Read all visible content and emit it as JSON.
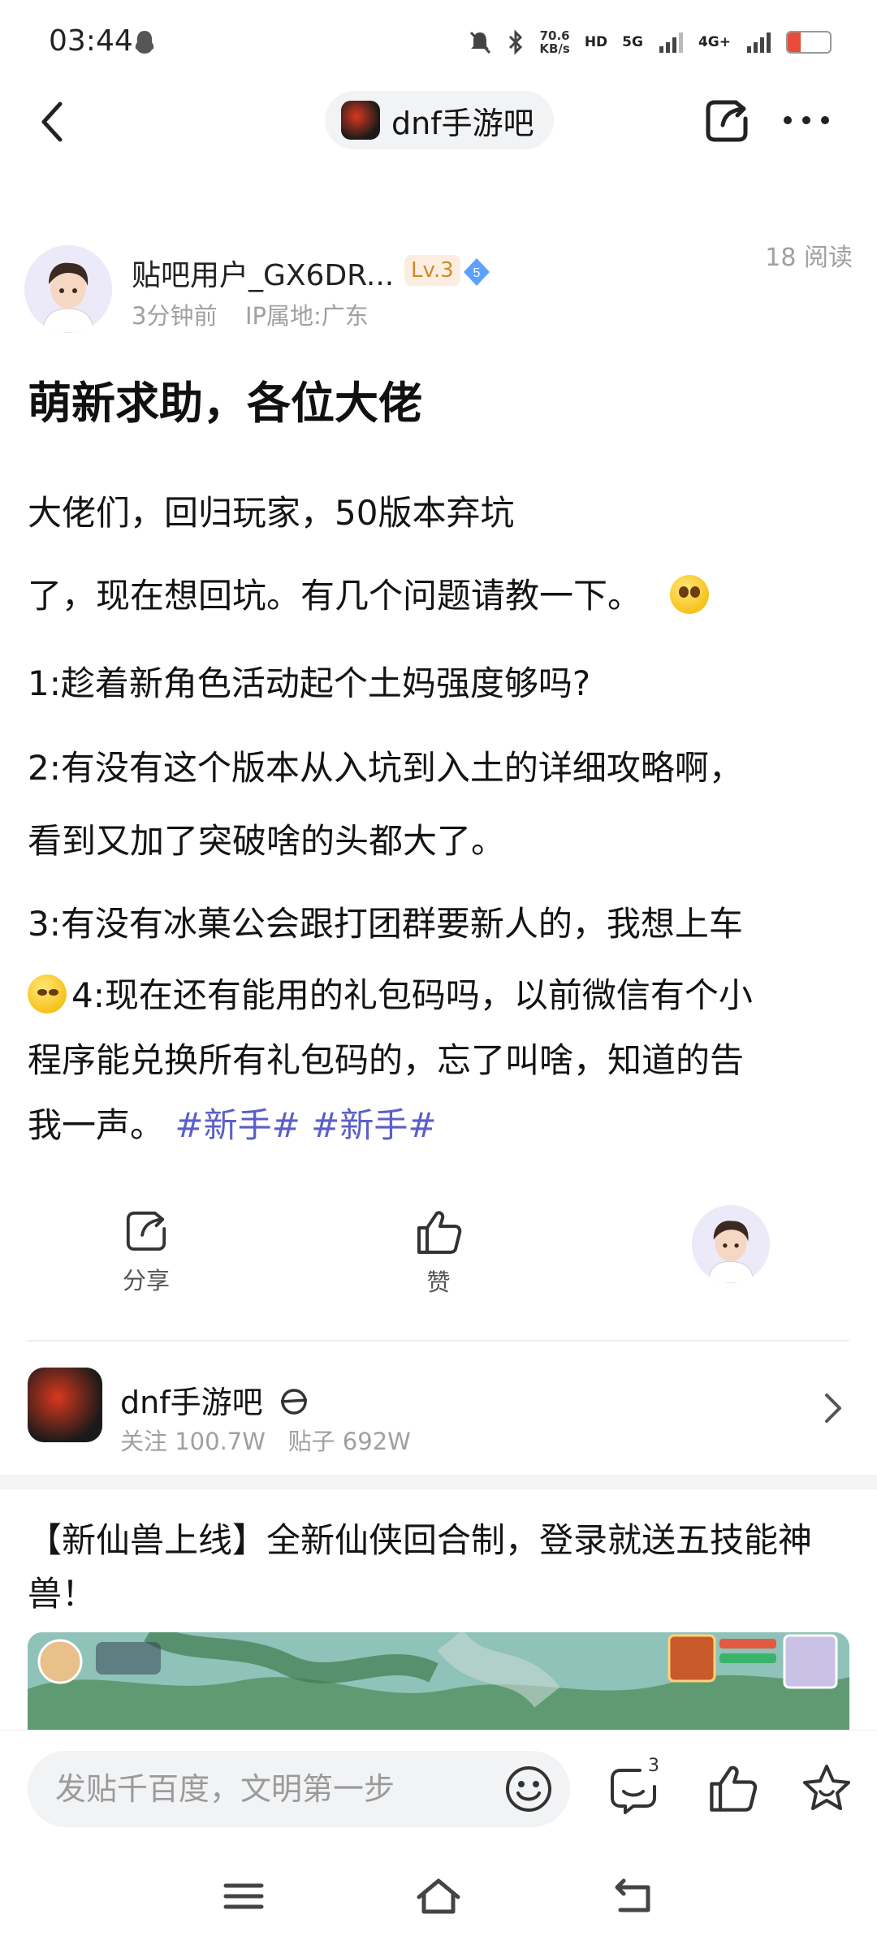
{
  "status_bar": {
    "time": "03:44",
    "net_speed_value": "70.6",
    "net_speed_unit": "KB/s",
    "hd": "HD",
    "sim1": "5G",
    "sim2": "4G+",
    "battery": "15"
  },
  "nav": {
    "forum_name": "dnf手游吧"
  },
  "author": {
    "name": "贴吧用户_GX6DR...",
    "level": "Lv.3",
    "badge_number": "5",
    "time": "3分钟前",
    "ip": "IP属地:广东",
    "reads": "18 阅读"
  },
  "post": {
    "title": "萌新求助，各位大佬",
    "line1": "大佬们，回归玩家，50版本弃坑",
    "line2": "了，现在想回坑。有几个问题请教一下。",
    "line3": "1:趁着新角色活动起个土妈强度够吗?",
    "line4": "2:有没有这个版本从入坑到入土的详细攻略啊，",
    "line5": "看到又加了突破啥的头都大了。",
    "line6": "3:有没有冰菓公会跟打团群要新人的，我想上车",
    "line7": "4:现在还有能用的礼包码吗，以前微信有个小",
    "line8": "程序能兑换所有礼包码的，忘了叫啥，知道的告",
    "line9": "我一声。",
    "tag1": "#新手#",
    "tag2": "#新手#"
  },
  "actions": {
    "share": "分享",
    "like": "赞"
  },
  "forum_card": {
    "name": "dnf手游吧",
    "stats": "关注 100.7W   贴子 692W"
  },
  "ad": {
    "title": "【新仙兽上线】全新仙侠回合制，登录就送五技能神兽！"
  },
  "bottom_bar": {
    "placeholder": "发贴千百度，文明第一步",
    "comment_count": "3"
  },
  "colors": {
    "tag": "#5b5fc7",
    "level_badge_bg": "#fbeee0",
    "level_badge_text": "#d0882e",
    "verified_badge": "#5aa2ff",
    "muted_text": "#a0a0a0"
  }
}
